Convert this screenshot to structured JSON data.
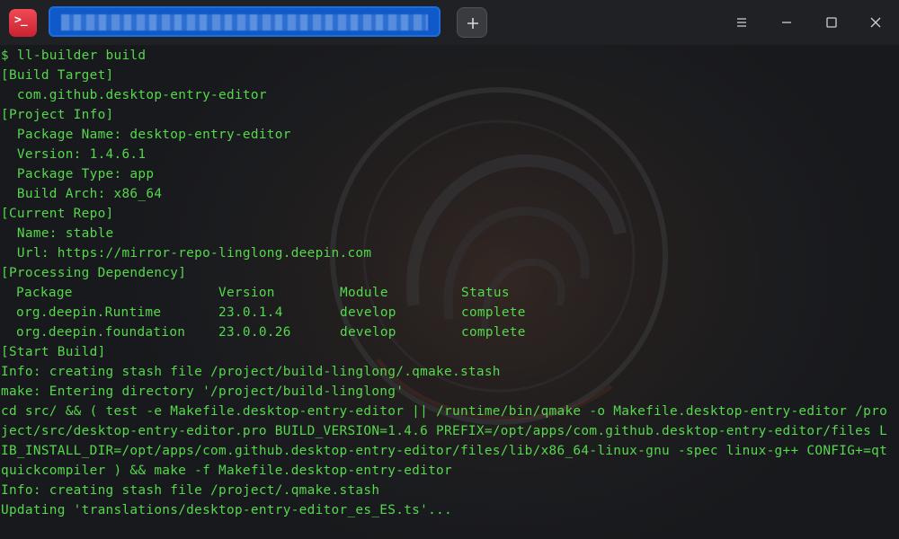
{
  "window": {
    "tab_title": "",
    "new_tab_icon": "plus-icon",
    "controls": [
      "menu-icon",
      "minimize-icon",
      "maximize-icon",
      "close-icon"
    ]
  },
  "colors": {
    "text": "#55d84c",
    "background": "#1c1d20",
    "titlebar": "#202124",
    "tab_active": "#0f5ac8",
    "app_icon": "#e0333f"
  },
  "terminal": {
    "lines": [
      "$ ll-builder build",
      "[Build Target]",
      "  com.github.desktop-entry-editor",
      "[Project Info]",
      "  Package Name: desktop-entry-editor",
      "  Version: 1.4.6.1",
      "  Package Type: app",
      "  Build Arch: x86_64",
      "[Current Repo]",
      "  Name: stable",
      "  Url: https://mirror-repo-linglong.deepin.com",
      "[Processing Dependency]"
    ],
    "dependency_table": {
      "headers": [
        "Package",
        "Version",
        "Module",
        "Status"
      ],
      "rows": [
        [
          "org.deepin.Runtime",
          "23.0.1.4",
          "develop",
          "complete"
        ],
        [
          "org.deepin.foundation",
          "23.0.0.26",
          "develop",
          "complete"
        ]
      ]
    },
    "lines_after": [
      "[Start Build]",
      "Info: creating stash file /project/build-linglong/.qmake.stash",
      "make: Entering directory '/project/build-linglong'",
      "cd src/ && ( test -e Makefile.desktop-entry-editor || /runtime/bin/qmake -o Makefile.desktop-entry-editor /pro",
      "ject/src/desktop-entry-editor.pro BUILD_VERSION=1.4.6 PREFIX=/opt/apps/com.github.desktop-entry-editor/files L",
      "IB_INSTALL_DIR=/opt/apps/com.github.desktop-entry-editor/files/lib/x86_64-linux-gnu -spec linux-g++ CONFIG+=qt",
      "quickcompiler ) && make -f Makefile.desktop-entry-editor",
      "Info: creating stash file /project/.qmake.stash",
      "Updating 'translations/desktop-entry-editor_es_ES.ts'..."
    ]
  }
}
